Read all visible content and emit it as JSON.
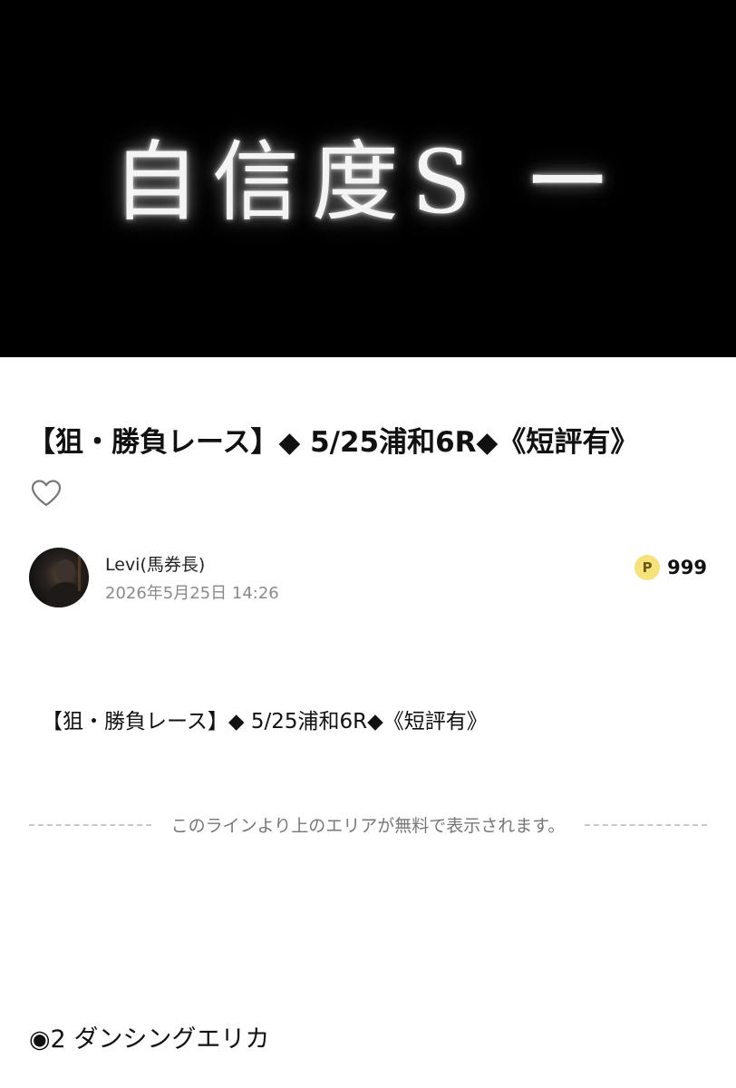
{
  "hero": {
    "text": "自信度S ー"
  },
  "article": {
    "title": "【狙・勝負レース】◆ 5/25浦和6R◆《短評有》",
    "body_line": "【狙・勝負レース】◆ 5/25浦和6R◆《短評有》",
    "paywall_notice": "このラインより上のエリアが無料で表示されます。",
    "pick_line": "◉2 ダンシングエリカ"
  },
  "author": {
    "name": "Levi(馬券長)",
    "date": "2026年5月25日 14:26"
  },
  "points": {
    "badge": "P",
    "count": "999"
  },
  "icons": {
    "like": "heart-outline-icon",
    "points": "point-coin-icon"
  },
  "colors": {
    "hero_bg": "#000000",
    "point_badge": "#f6e27a",
    "muted_text": "#8a8a8a"
  }
}
